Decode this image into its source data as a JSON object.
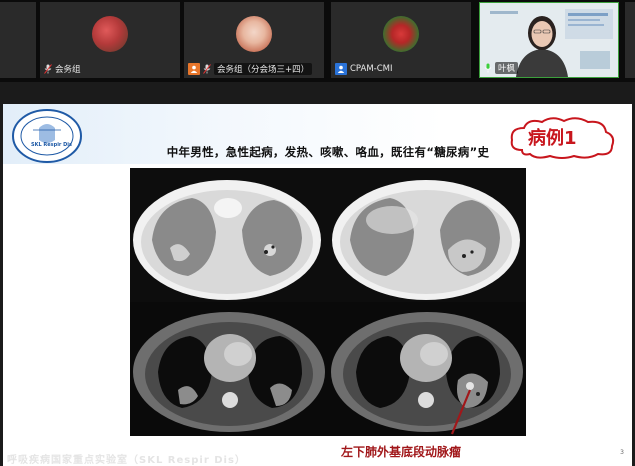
{
  "participants": [
    {
      "label": "会务组"
    },
    {
      "label": "会务组（分会场三+四）"
    },
    {
      "label": "CPAM-CMI"
    },
    {
      "label": "叶枫"
    }
  ],
  "slide": {
    "title": "中年男性，急性起病，发热、咳嗽、咯血，既往有“糖尿病”史",
    "case_label": "病例1",
    "caption": "左下肺外基底段动脉瘤",
    "page_number": "3",
    "footer": "呼吸疾病国家重点实验室（SKL Respir Dis）",
    "logo_text": "SKL Respir Dis"
  },
  "colors": {
    "case_label_red": "#c8161d",
    "caption_red": "#a1171a",
    "logo_blue": "#1f5aa6"
  }
}
